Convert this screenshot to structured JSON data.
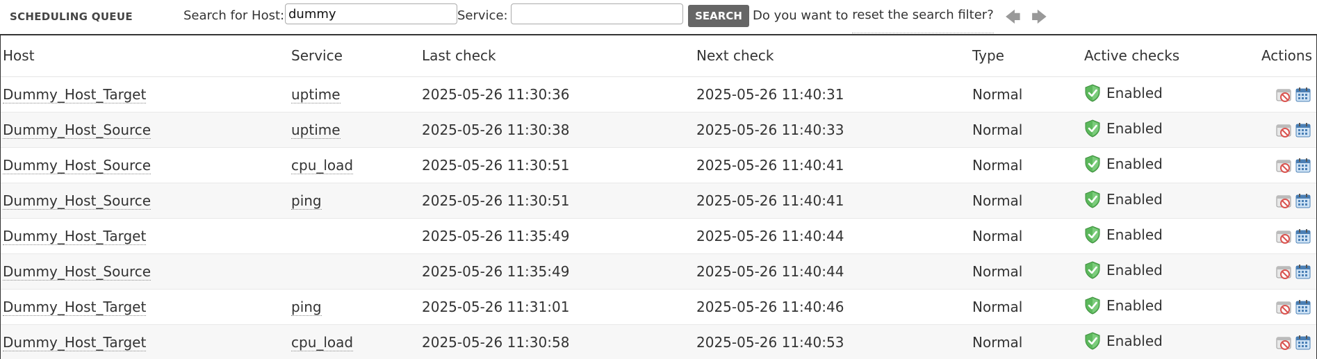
{
  "header": {
    "title": "SCHEDULING QUEUE",
    "host_label": "Search for Host:",
    "host_value": "dummy",
    "service_label": "Service:",
    "service_value": "",
    "search_button": "SEARCH",
    "question": "Do you want to",
    "reset_link": "reset the search filter?",
    "prev_icon": "arrow-left-icon",
    "next_icon": "arrow-right-icon"
  },
  "table": {
    "columns": [
      "Host",
      "Service",
      "Last check",
      "Next check",
      "Type",
      "Active checks",
      "Actions"
    ],
    "rows": [
      {
        "host": "Dummy_Host_Target",
        "service": "uptime",
        "last": "2025-05-26 11:30:36",
        "next": "2025-05-26 11:40:31",
        "type": "Normal",
        "active": "Enabled"
      },
      {
        "host": "Dummy_Host_Source",
        "service": "uptime",
        "last": "2025-05-26 11:30:38",
        "next": "2025-05-26 11:40:33",
        "type": "Normal",
        "active": "Enabled"
      },
      {
        "host": "Dummy_Host_Source",
        "service": "cpu_load",
        "last": "2025-05-26 11:30:51",
        "next": "2025-05-26 11:40:41",
        "type": "Normal",
        "active": "Enabled"
      },
      {
        "host": "Dummy_Host_Source",
        "service": "ping",
        "last": "2025-05-26 11:30:51",
        "next": "2025-05-26 11:40:41",
        "type": "Normal",
        "active": "Enabled"
      },
      {
        "host": "Dummy_Host_Target",
        "service": "",
        "last": "2025-05-26 11:35:49",
        "next": "2025-05-26 11:40:44",
        "type": "Normal",
        "active": "Enabled"
      },
      {
        "host": "Dummy_Host_Source",
        "service": "",
        "last": "2025-05-26 11:35:49",
        "next": "2025-05-26 11:40:44",
        "type": "Normal",
        "active": "Enabled"
      },
      {
        "host": "Dummy_Host_Target",
        "service": "ping",
        "last": "2025-05-26 11:31:01",
        "next": "2025-05-26 11:40:46",
        "type": "Normal",
        "active": "Enabled"
      },
      {
        "host": "Dummy_Host_Target",
        "service": "cpu_load",
        "last": "2025-05-26 11:30:58",
        "next": "2025-05-26 11:40:53",
        "type": "Normal",
        "active": "Enabled"
      }
    ],
    "icons": {
      "active": "shield-check-icon",
      "disable": "disable-check-icon",
      "reschedule": "reschedule-icon"
    }
  },
  "colors": {
    "accent_button": "#666666",
    "shield_green": "#5cb85c",
    "row_alt": "#f7f7f7"
  }
}
